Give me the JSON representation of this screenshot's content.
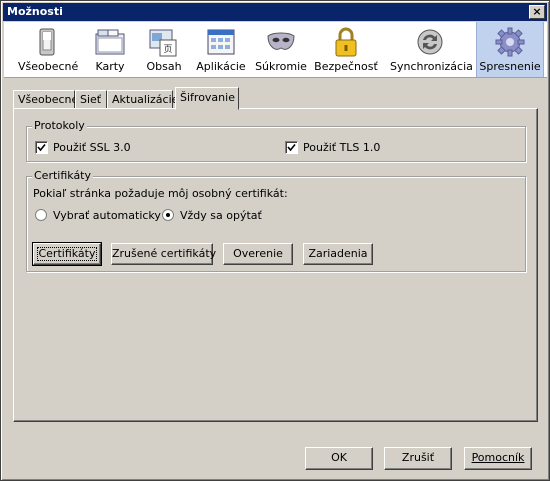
{
  "window": {
    "title": "Možnosti",
    "close_label": "×"
  },
  "toolbar": {
    "items": [
      {
        "label": "Všeobecné",
        "icon": "general-icon"
      },
      {
        "label": "Karty",
        "icon": "tabs-icon"
      },
      {
        "label": "Obsah",
        "icon": "content-icon"
      },
      {
        "label": "Aplikácie",
        "icon": "applications-icon"
      },
      {
        "label": "Súkromie",
        "icon": "privacy-mask-icon"
      },
      {
        "label": "Bezpečnosť",
        "icon": "security-lock-icon"
      },
      {
        "label": "Synchronizácia",
        "icon": "sync-icon"
      },
      {
        "label": "Spresnenie",
        "icon": "advanced-gear-icon",
        "selected": true
      }
    ]
  },
  "tabs": [
    "Všeobecné",
    "Sieť",
    "Aktualizácie",
    "Šifrovanie"
  ],
  "active_tab": "Šifrovanie",
  "protocols": {
    "legend": "Protokoly",
    "ssl": {
      "label": "Použiť SSL 3.0",
      "checked": true
    },
    "tls": {
      "label": "Použiť TLS 1.0",
      "checked": true
    }
  },
  "certificates": {
    "legend": "Certifikáty",
    "prompt": "Pokiaľ stránka požaduje môj osobný certifikát:",
    "radio_auto": {
      "label": "Vybrať automaticky",
      "selected": false
    },
    "radio_ask": {
      "label": "Vždy sa opýtať",
      "selected": true
    },
    "buttons": [
      "Certifikáty",
      "Zrušené certifikáty",
      "Overenie",
      "Zariadenia"
    ]
  },
  "footer": {
    "ok": "OK",
    "cancel": "Zrušiť",
    "help": "Pomocník"
  },
  "colors": {
    "titlebar": "#0a246a",
    "face": "#d4d0c8",
    "selected_toolbar": "#c1d2ee"
  }
}
